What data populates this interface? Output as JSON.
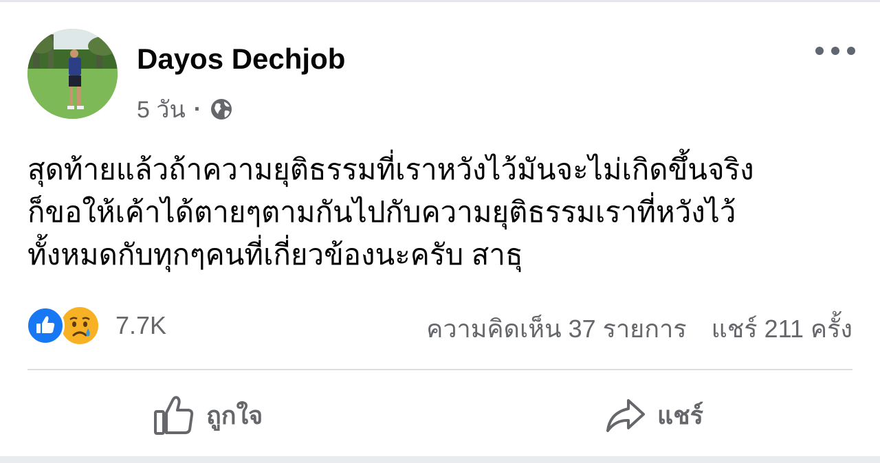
{
  "post": {
    "author": "Dayos Dechjob",
    "time": "5 วัน",
    "separator": "·",
    "privacy_icon": "globe-icon",
    "text": "สุดท้ายแล้วถ้าความยุติธรรมที่เราหวังไว้มันจะไม่เกิดขึ้นจริง\nก็ขอให้เค้าได้ตายๆตามกันไปกับความยุติธรรมเราที่หวังไว้\nทั้งหมดกับทุกๆคนที่เกี่ยวข้องนะครับ สาธุ"
  },
  "reactions": {
    "icons": [
      "like-icon",
      "sad-icon"
    ],
    "count": "7.7K"
  },
  "stats": {
    "comments": "ความคิดเห็น 37 รายการ",
    "shares": "แชร์ 211 ครั้ง"
  },
  "actions": {
    "like_label": "ถูกใจ",
    "share_label": "แชร์"
  },
  "colors": {
    "like_blue": "#1877f2",
    "secondary_text": "#65676b"
  }
}
